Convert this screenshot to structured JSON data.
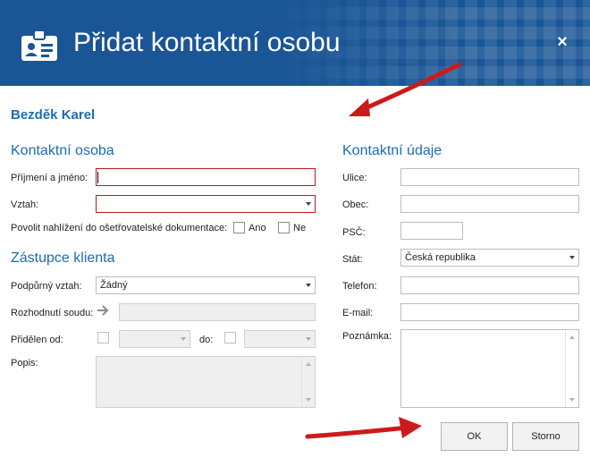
{
  "dialog": {
    "title": "Přidat kontaktní osobu",
    "close_label": "×",
    "client_name": "Bezděk Karel"
  },
  "contact_person": {
    "section_title": "Kontaktní osoba",
    "name_label": "Příjmení a jméno:",
    "name_value": "",
    "relation_label": "Vztah:",
    "relation_value": "",
    "allow_docs_label": "Povolit nahlížení do ošetřovatelské dokumentace:",
    "yes_label": "Ano",
    "no_label": "Ne"
  },
  "representative": {
    "section_title": "Zástupce klienta",
    "support_relation_label": "Podpůrný vztah:",
    "support_relation_value": "Žádný",
    "court_decision_label": "Rozhodnutí soudu:",
    "assigned_from_label": "Přidělen od:",
    "to_label": "do:",
    "description_label": "Popis:"
  },
  "contact_details": {
    "section_title": "Kontaktní údaje",
    "street_label": "Ulice:",
    "city_label": "Obec:",
    "zip_label": "PSČ:",
    "country_label": "Stát:",
    "country_value": "Česká republika",
    "phone_label": "Telefon:",
    "email_label": "E-mail:",
    "note_label": "Poznámka:"
  },
  "buttons": {
    "ok_label": "OK",
    "cancel_label": "Storno"
  },
  "colors": {
    "header_bg": "#1a5596",
    "accent_text": "#1d6cb3",
    "required_border": "#c01818",
    "annotation_arrow": "#cc1a1a"
  }
}
